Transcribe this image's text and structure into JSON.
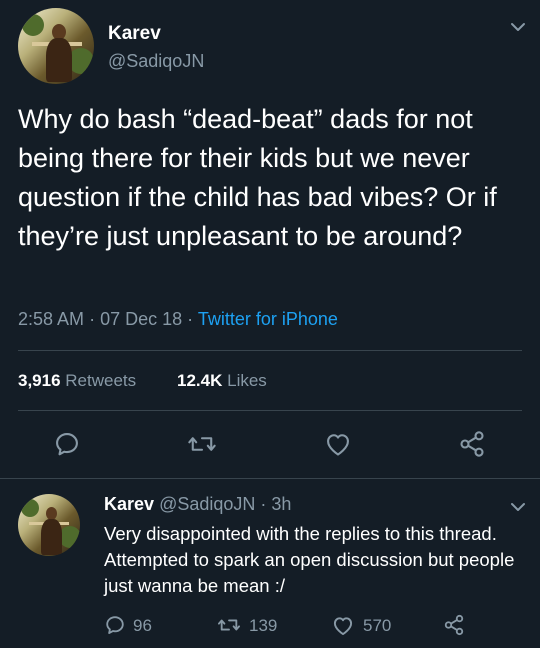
{
  "tweet": {
    "author_name": "Karev",
    "author_handle": "@SadiqoJN",
    "text": "Why do bash “dead-beat” dads for not being there for their kids but we never question if the child has bad vibes? Or if they’re just unpleasant to be around?",
    "time": "2:58 AM",
    "date": "07 Dec 18",
    "source": "Twitter for iPhone",
    "retweets_count": "3,916",
    "retweets_label": "Retweets",
    "likes_count": "12.4K",
    "likes_label": "Likes"
  },
  "reply": {
    "author_name": "Karev",
    "author_handle": "@SadiqoJN",
    "age": "3h",
    "text": "Very disappointed with the replies to this thread. Attempted to spark an open discussion but people just wanna be mean :/",
    "replies_count": "96",
    "retweets_count": "139",
    "likes_count": "570"
  },
  "colors": {
    "background": "#141d26",
    "text": "#ffffff",
    "muted": "#8899a6",
    "link": "#1da1f2",
    "divider": "#38444d"
  },
  "icons": [
    "chevron-down-icon",
    "reply-icon",
    "retweet-icon",
    "like-icon",
    "share-icon"
  ]
}
